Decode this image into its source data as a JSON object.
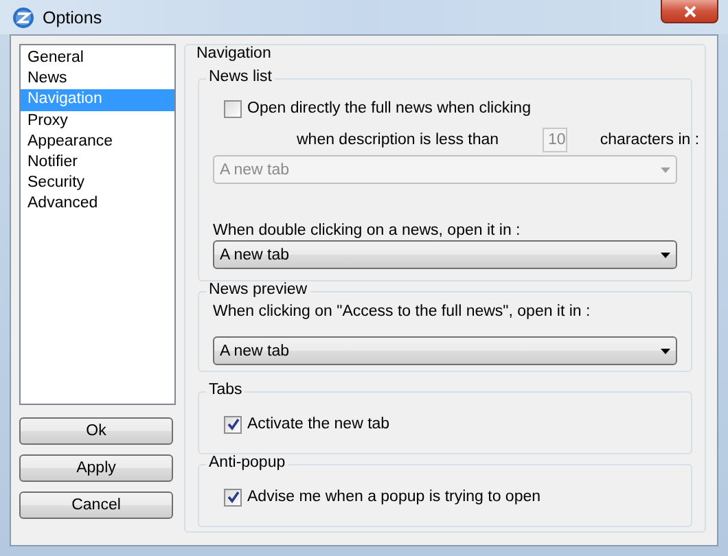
{
  "window": {
    "title": "Options"
  },
  "sidebar": {
    "items": [
      {
        "label": "General",
        "selected": false
      },
      {
        "label": "News",
        "selected": false
      },
      {
        "label": "Navigation",
        "selected": true
      },
      {
        "label": "Proxy",
        "selected": false
      },
      {
        "label": "Appearance",
        "selected": false
      },
      {
        "label": "Notifier",
        "selected": false
      },
      {
        "label": "Security",
        "selected": false
      },
      {
        "label": "Advanced",
        "selected": false
      }
    ]
  },
  "buttons": [
    "Ok",
    "Apply",
    "Cancel"
  ],
  "panel": {
    "title": "Navigation",
    "groups": [
      {
        "title": "News list",
        "controls": [
          {
            "kind": "checkbox",
            "label": "Open directly the full news when clicking",
            "checked": false
          },
          {
            "kind": "number",
            "label": "when description is less than",
            "value": "10",
            "suffix": "characters in :",
            "disabled": true
          },
          {
            "kind": "dropdown",
            "value": "A new tab",
            "disabled": true
          },
          {
            "kind": "label",
            "text": "When double clicking on a news, open it in :"
          },
          {
            "kind": "dropdown",
            "value": "A new tab",
            "disabled": false
          }
        ]
      },
      {
        "title": "News preview",
        "controls": [
          {
            "kind": "label",
            "text": "When clicking on \"Access to the full news\", open it in :"
          },
          {
            "kind": "dropdown",
            "value": "A new tab",
            "disabled": false
          }
        ]
      },
      {
        "title": "Tabs",
        "controls": [
          {
            "kind": "checkbox",
            "label": "Activate the new tab",
            "checked": true
          }
        ]
      },
      {
        "title": "Anti-popup",
        "controls": [
          {
            "kind": "checkbox",
            "label": "Advise me when a popup is trying to open",
            "checked": true
          }
        ]
      }
    ]
  }
}
